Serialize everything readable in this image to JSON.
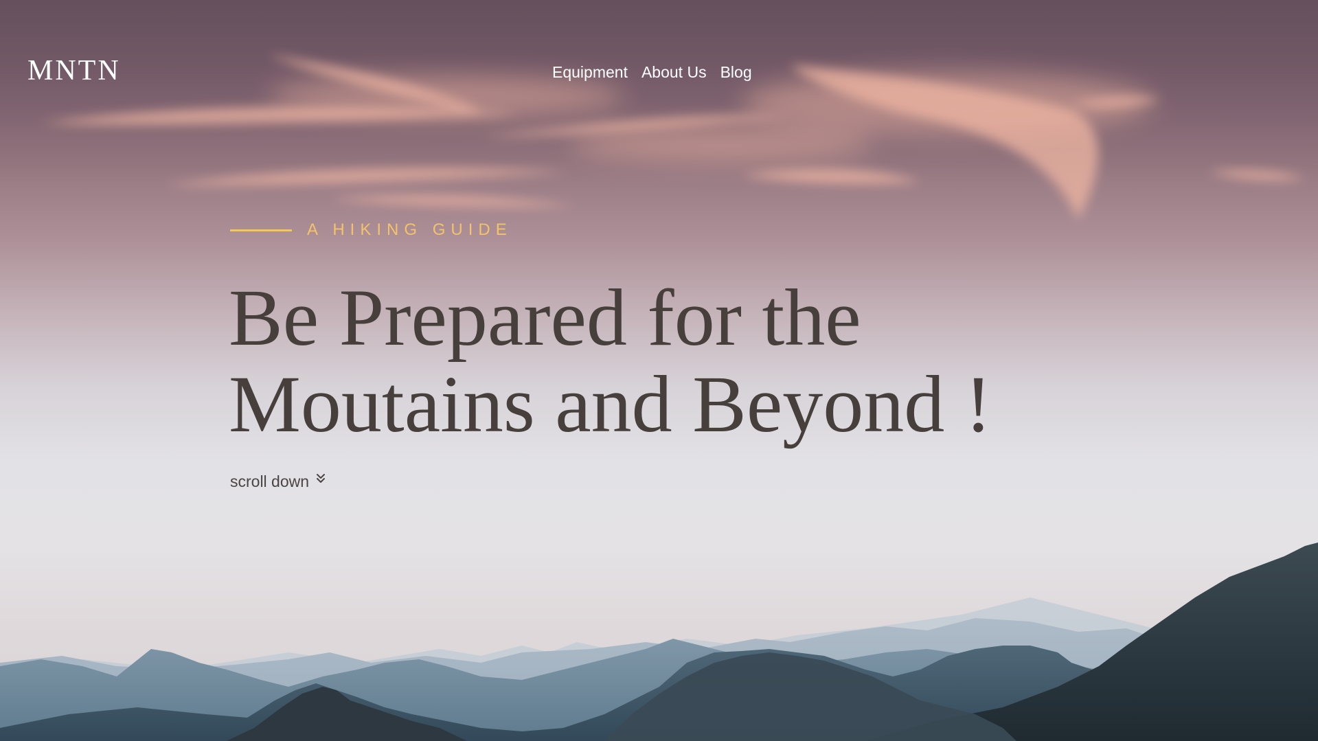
{
  "header": {
    "logo": "MNTN",
    "nav": [
      {
        "label": "Equipment"
      },
      {
        "label": "About Us"
      },
      {
        "label": "Blog"
      }
    ]
  },
  "hero": {
    "eyebrow": "A HIKING GUIDE",
    "headline_line1": "Be Prepared for the",
    "headline_line2": "Moutains and Beyond !",
    "scroll_label": "scroll down",
    "scroll_icon": "double-chevron-down-icon"
  },
  "colors": {
    "accent": "#f3c26a",
    "headline": "#463f3c",
    "nav_text": "#ffffff"
  }
}
